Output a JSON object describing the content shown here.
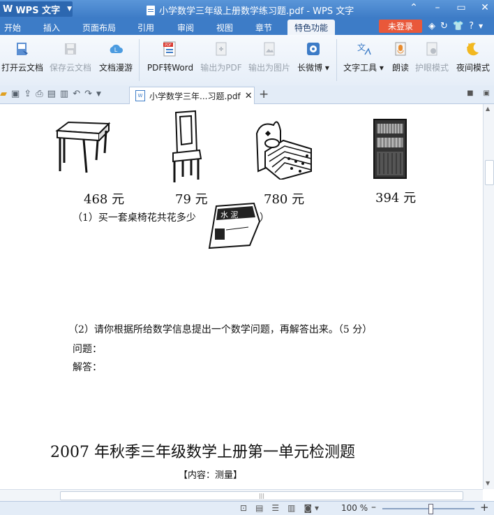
{
  "window": {
    "app_name": "WPS 文字",
    "title": "小学数学三年级上册数学练习题.pdf - WPS 文字"
  },
  "menu": {
    "tabs": [
      "开始",
      "插入",
      "页面布局",
      "引用",
      "审阅",
      "视图",
      "章节",
      "特色功能"
    ],
    "active_tab": "特色功能",
    "login_label": "未登录"
  },
  "ribbon": {
    "open_cloud": "打开云文档",
    "save_cloud": "保存云文档",
    "doc_roam": "文档漫游",
    "pdf_to_word": "PDF转Word",
    "export_pdf": "输出为PDF",
    "export_image": "输出为图片",
    "long_weibo": "长微博",
    "text_tools": "文字工具",
    "read_aloud": "朗读",
    "eye_mode": "护眼模式",
    "night_mode": "夜间模式"
  },
  "document_tab": {
    "name": "小学数学三年...习题.pdf"
  },
  "document": {
    "prices": [
      "468 元",
      "79 元",
      "780 元",
      "394 元"
    ],
    "q1": "（1）买一套桌椅花共花多少",
    "q1_end": "）",
    "q2": "（2）请你根据所给数学信息提出一个数学问题，再解答出来。（5 分）",
    "question_label": "问题：",
    "answer_label": "解答：",
    "section_title": "2007 年秋季三年级数学上册第一单元检测题",
    "content_label": "【内容：测量】"
  },
  "status": {
    "zoom": "100 %"
  }
}
